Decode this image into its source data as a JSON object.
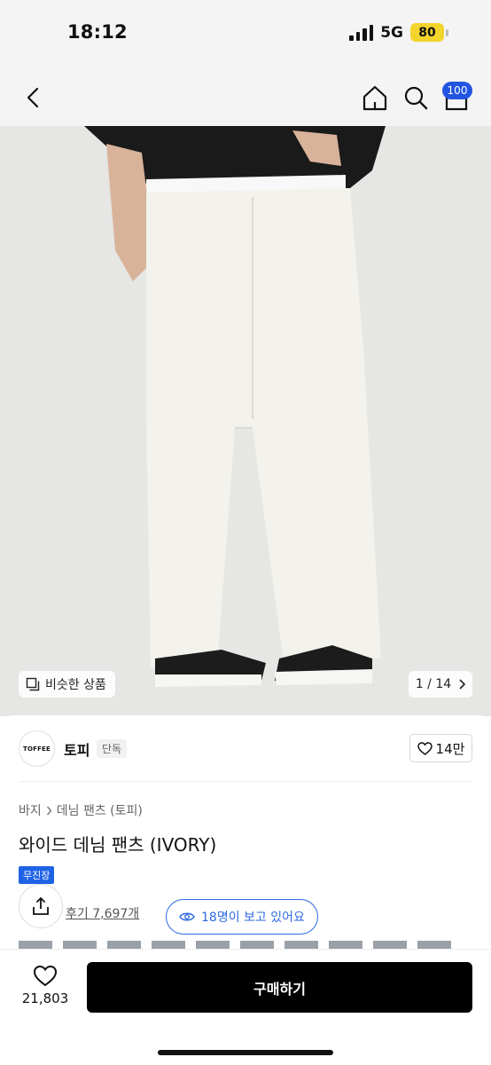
{
  "status_bar": {
    "time": "18:12",
    "network": "5G",
    "battery": "80"
  },
  "nav": {
    "cart_badge": "100"
  },
  "image": {
    "similar_label": "비슷한 상품",
    "page_counter": "1 / 14"
  },
  "brand": {
    "logo_text": "TOFFEE",
    "name": "토피",
    "exclusive_tag": "단독",
    "likes": "14만"
  },
  "product": {
    "breadcrumb": [
      "바지",
      "데님 팬츠 (토피)"
    ],
    "title": "와이드 데님 팬츠 (IVORY)",
    "free_shipping_tag": "무진장",
    "reviews_link": "후기 7,697개",
    "viewers": "18명이 보고 있어요"
  },
  "bottom": {
    "wish_count": "21,803",
    "buy_label": "구매하기"
  },
  "colors": {
    "accent_blue": "#2f6ae3",
    "badge_blue": "#2255e0",
    "tag_blue": "#1e63e6",
    "battery_yellow": "#f3d42c",
    "buy_button": "#000000"
  }
}
